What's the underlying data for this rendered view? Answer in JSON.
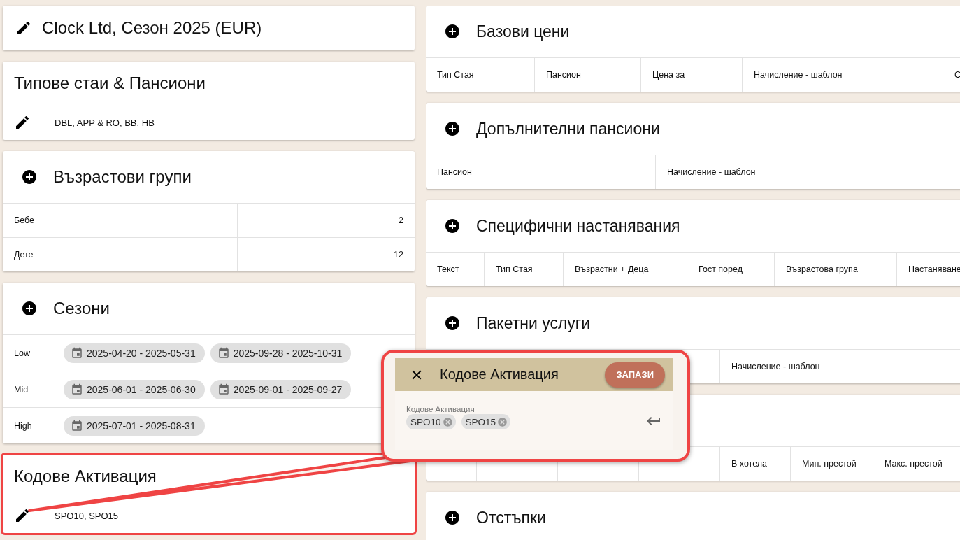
{
  "header": {
    "title": "Clock Ltd, Сезон 2025 (EUR)"
  },
  "room_types": {
    "title": "Типове стаи & Пансиони",
    "value": "DBL, APP & RO, BB, HB"
  },
  "age_groups": {
    "title": "Възрастови групи",
    "rows": [
      {
        "name": "Бебе",
        "age": "2"
      },
      {
        "name": "Дете",
        "age": "12"
      }
    ]
  },
  "seasons": {
    "title": "Сезони",
    "rows": [
      {
        "name": "Low",
        "periods": [
          "2025-04-20 - 2025-05-31",
          "2025-09-28 - 2025-10-31"
        ]
      },
      {
        "name": "Mid",
        "periods": [
          "2025-06-01 - 2025-06-30",
          "2025-09-01 - 2025-09-27"
        ]
      },
      {
        "name": "High",
        "periods": [
          "2025-07-01 - 2025-08-31"
        ]
      }
    ]
  },
  "activation_codes": {
    "title": "Кодове Активация",
    "value": "SPO10, SPO15",
    "highlighted": true
  },
  "right_cards": [
    {
      "title": "Базови цени",
      "columns": [
        "Тип Стая",
        "Пансион",
        "Цена за",
        "Начисление - шаблон",
        "С"
      ]
    },
    {
      "title": "Допълнителни пансиони",
      "columns": [
        "Пансион",
        "Начисление - шаблон"
      ]
    },
    {
      "title": "Специфични настанявания",
      "columns": [
        "Текст",
        "Тип Стая",
        "Възрастни + Деца",
        "Гост поред",
        "Възрастова група",
        "Настаняване"
      ]
    },
    {
      "title": "Пакетни услуги",
      "columns": [
        "Начисление - шаблон"
      ]
    },
    {
      "columns": [
        "В хотела",
        "Мин. престой",
        "Макс. престой"
      ]
    },
    {
      "title": "Отстъпки"
    }
  ],
  "dialog": {
    "title": "Кодове Активация",
    "save_label": "ЗАПАЗИ",
    "field": {
      "label": "Кодове Активация",
      "chips": [
        "SPO10",
        "SPO15"
      ]
    }
  }
}
